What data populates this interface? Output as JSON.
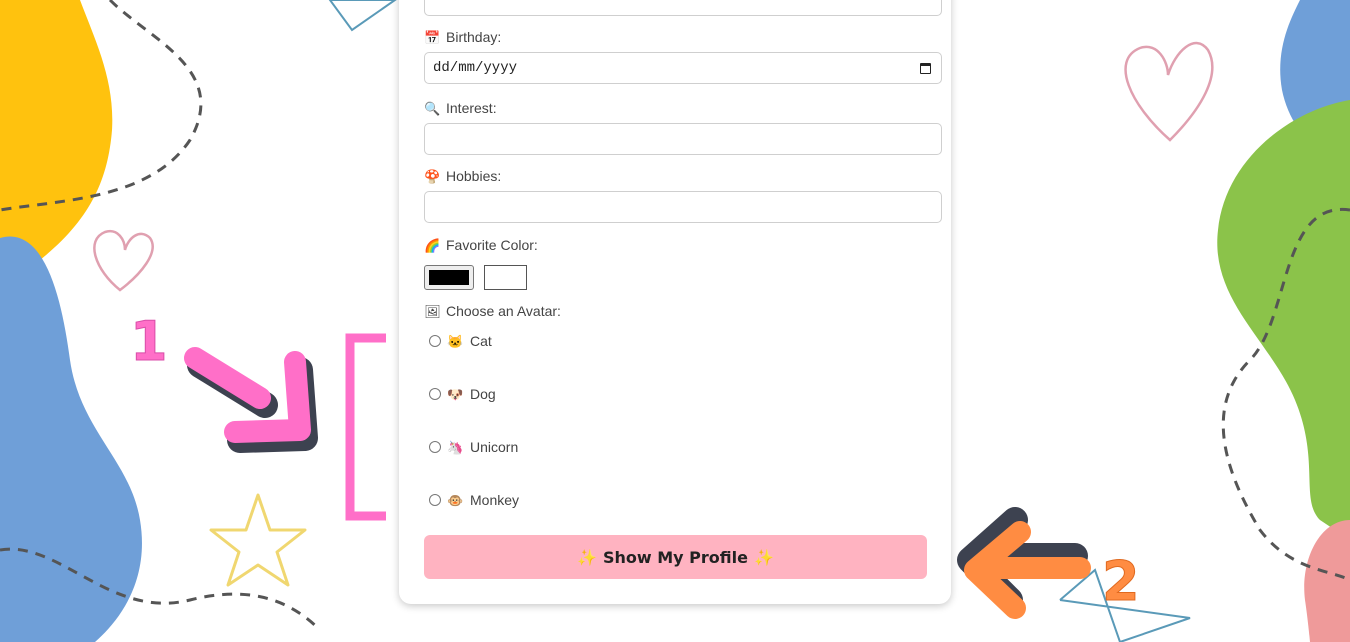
{
  "form": {
    "birthday_label": "Birthday:",
    "birthday_placeholder": "dd/mm/yyyy",
    "interest_label": "Interest:",
    "hobbies_label": "Hobbies:",
    "favorite_color_label": "Favorite Color:",
    "avatar_label": "Choose an Avatar:",
    "avatars": [
      {
        "label": "Cat",
        "emoji": "🐱"
      },
      {
        "label": "Dog",
        "emoji": "🐶"
      },
      {
        "label": "Unicorn",
        "emoji": "🦄"
      },
      {
        "label": "Monkey",
        "emoji": "🐵"
      }
    ],
    "submit_label": "Show My Profile",
    "selected_color": "#000000",
    "icons": {
      "birthday": "calendar-icon",
      "interest": "magnifier-icon",
      "hobbies": "mushroom-icon",
      "favorite_color": "rainbow-icon",
      "avatar": "picture-icon",
      "submit": "sparkles-icon"
    }
  },
  "annotations": {
    "marker_1": "1",
    "marker_2": "2",
    "colors": {
      "pink_arrow": "#ff6fc8",
      "orange_arrow": "#ff8c42"
    }
  },
  "colors": {
    "yellow_blob": "#ffc20e",
    "blue_blob": "#6f9fd8",
    "green_blob": "#8bc34a",
    "pink_blob": "#ef9a9a",
    "button_bg": "#ffb3c1"
  }
}
